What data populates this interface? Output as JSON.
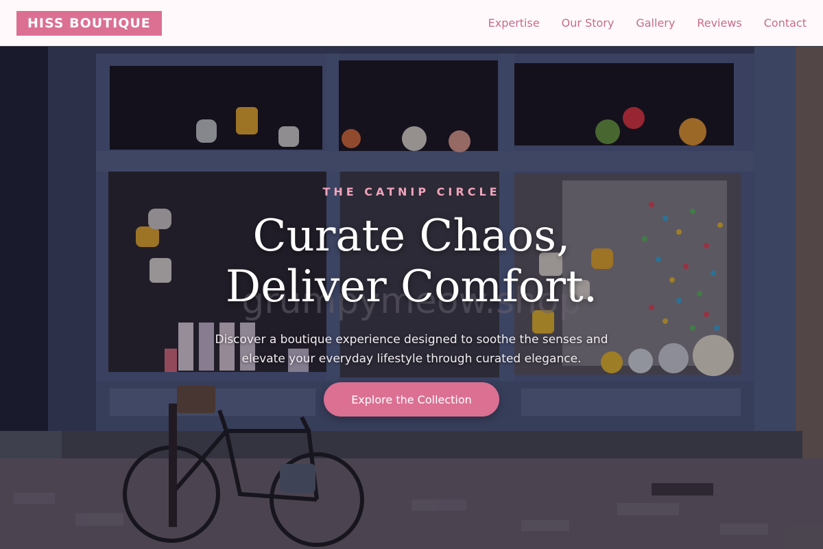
{
  "brand": {
    "name": "HISS BOUTIQUE"
  },
  "nav": {
    "links": [
      "Expertise",
      "Our Story",
      "Gallery",
      "Reviews",
      "Contact"
    ]
  },
  "hero": {
    "eyebrow": "THE CATNIP CIRCLE",
    "headline": "Curate Chaos, Deliver Comfort.",
    "subtext": "Discover a boutique experience designed to soothe the senses and elevate your everyday lifestyle through curated elegance.",
    "cta_label": "Explore the Collection",
    "window_sign": "grumpymeow.shop"
  },
  "colors": {
    "accent": "#db7093",
    "nav_link": "#c96a8b",
    "nav_background": "#fff9fb",
    "storefront_blue": "#4a5878"
  }
}
